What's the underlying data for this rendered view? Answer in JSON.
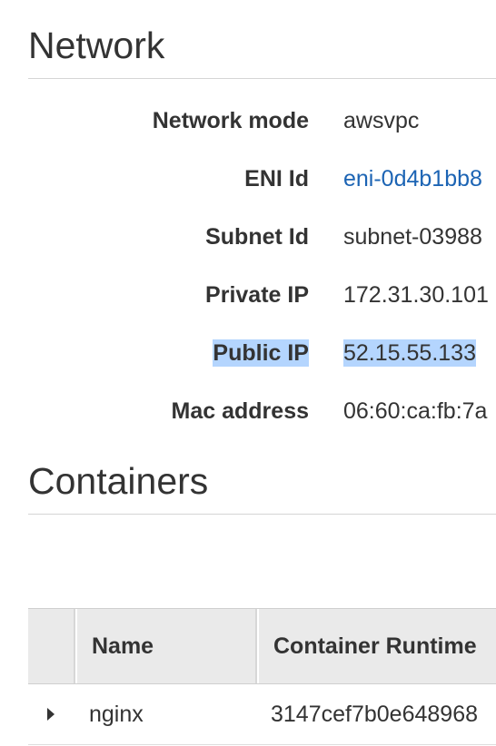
{
  "network": {
    "title": "Network",
    "fields": {
      "network_mode": {
        "label": "Network mode",
        "value": "awsvpc"
      },
      "eni_id": {
        "label": "ENI Id",
        "value": "eni-0d4b1bb8"
      },
      "subnet_id": {
        "label": "Subnet Id",
        "value": "subnet-03988"
      },
      "private_ip": {
        "label": "Private IP",
        "value": "172.31.30.101"
      },
      "public_ip": {
        "label": "Public IP",
        "value": "52.15.55.133"
      },
      "mac_address": {
        "label": "Mac address",
        "value": "06:60:ca:fb:7a"
      }
    }
  },
  "containers": {
    "title": "Containers",
    "columns": {
      "name": "Name",
      "runtime": "Container Runtime"
    },
    "rows": [
      {
        "name": "nginx",
        "runtime": "3147cef7b0e648968"
      }
    ]
  },
  "colors": {
    "link": "#1c64b4",
    "selection": "#b4d5fe",
    "header_bg": "#eaeaea",
    "text": "#333333"
  },
  "icons": {
    "row_expand": "caret-right-icon"
  }
}
